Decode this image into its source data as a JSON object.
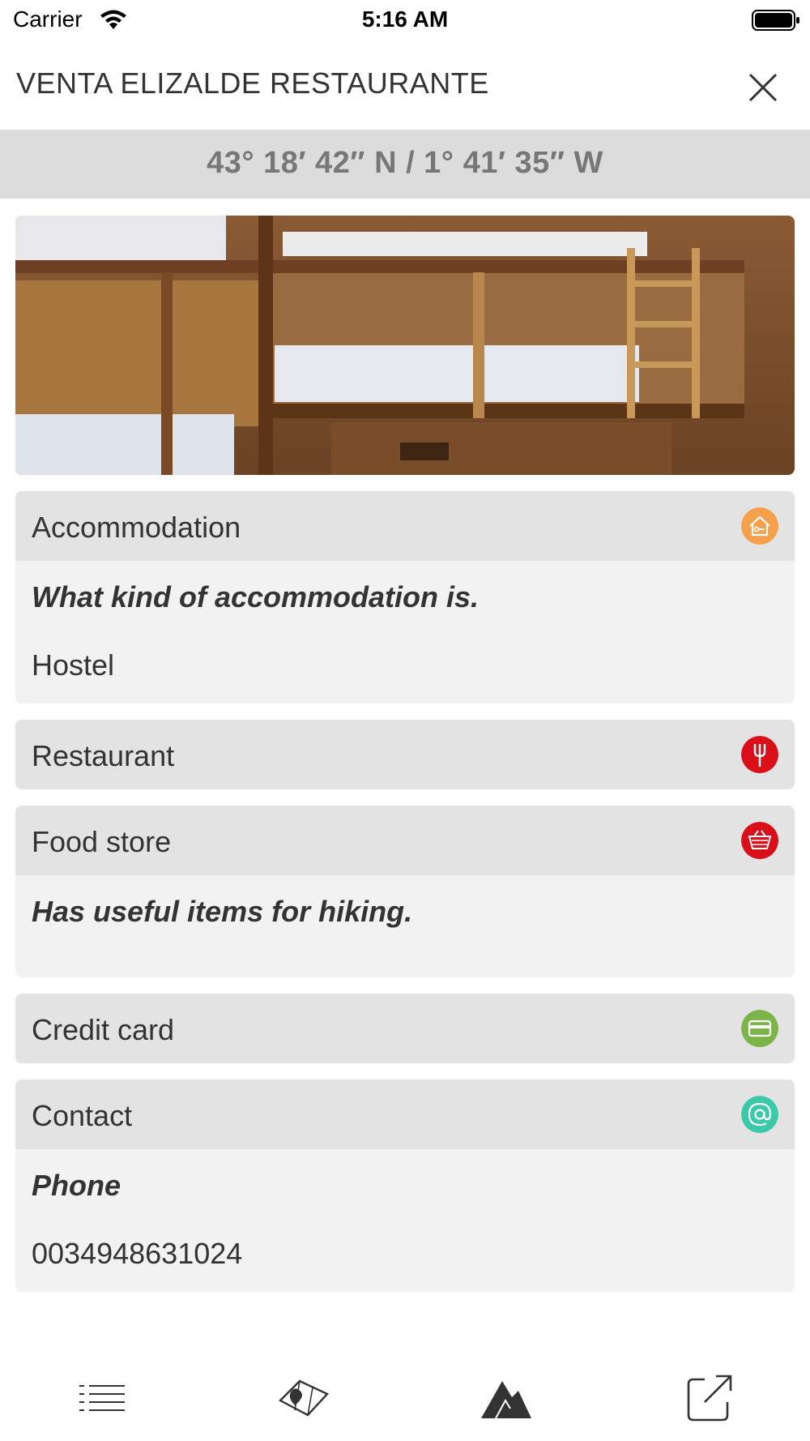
{
  "status_bar": {
    "carrier": "Carrier",
    "time": "5:16 AM"
  },
  "header": {
    "title": "VENTA ELIZALDE RESTAURANTE",
    "close_icon": "close-icon"
  },
  "coordinates": {
    "text": "43° 18′ 42″ N  /  1° 41′ 35″ W"
  },
  "photo": {
    "description_icon": "bunk-room-photo"
  },
  "sections": {
    "accommodation": {
      "title": "Accommodation",
      "icon": "house-key-icon",
      "color": "#f5a04a",
      "subtitle": "What kind of accommodation is.",
      "value": "Hostel"
    },
    "restaurant": {
      "title": "Restaurant",
      "icon": "fork-icon",
      "color": "#d9101a"
    },
    "food_store": {
      "title": "Food store",
      "icon": "basket-icon",
      "color": "#d9101a",
      "subtitle": "Has useful items for hiking."
    },
    "credit_card": {
      "title": "Credit card",
      "icon": "credit-card-icon",
      "color": "#7cb44a"
    },
    "contact": {
      "title": "Contact",
      "icon": "at-icon",
      "color": "#3cc9a9",
      "subtitle": "Phone",
      "value": "0034948631024"
    }
  },
  "tab_bar": {
    "tabs": [
      "list-icon",
      "map-icon",
      "mountain-icon",
      "share-icon"
    ]
  }
}
